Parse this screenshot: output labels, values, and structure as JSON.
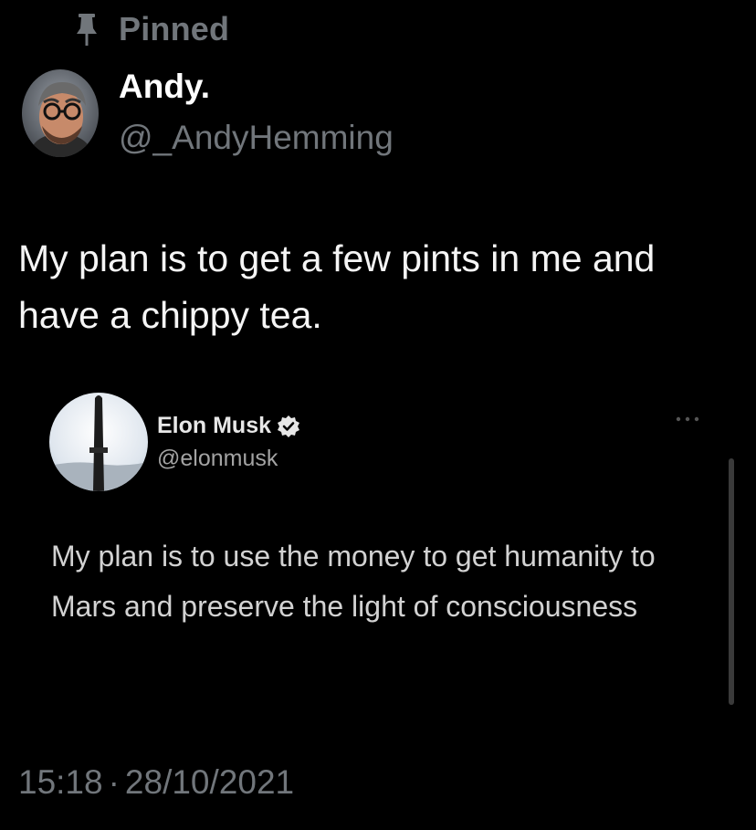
{
  "pinned": {
    "label": "Pinned",
    "icon": "pin-icon"
  },
  "author": {
    "name": "Andy.",
    "handle": "@_AndyHemming",
    "avatar_icon": "avatar"
  },
  "tweet": {
    "text": "My plan is to get a few pints in me and have a chippy tea."
  },
  "quote": {
    "name": "Elon Musk",
    "handle": "@elonmusk",
    "verified_icon": "verified-badge-icon",
    "more_icon": "more-options-icon",
    "text": "My plan is to use the money to get humanity to Mars and preserve the light of consciousness"
  },
  "timestamp": {
    "time": "15:18",
    "separator": "·",
    "date": "28/10/2021"
  },
  "colors": {
    "background": "#000000",
    "secondary_text": "#71767b",
    "primary_text": "#ffffff"
  }
}
